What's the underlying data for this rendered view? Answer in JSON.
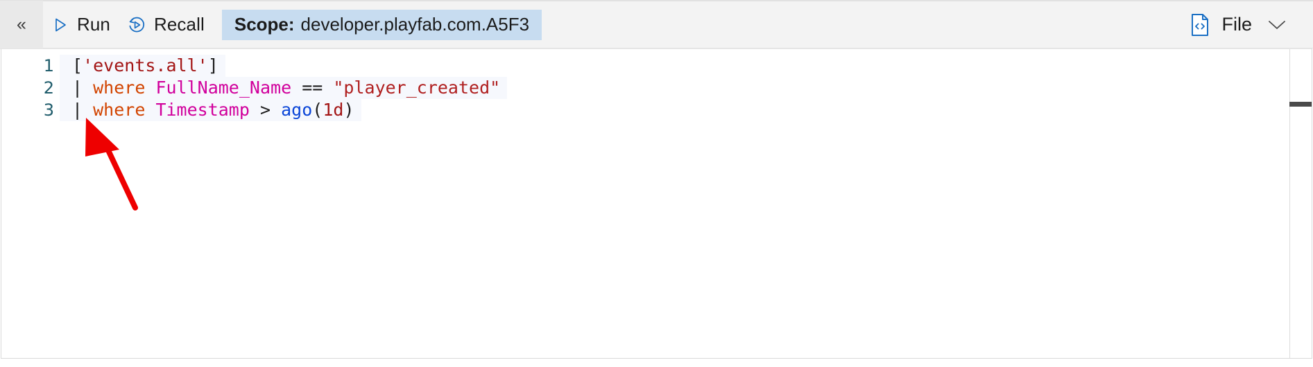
{
  "toolbar": {
    "collapse_label": "«",
    "collapse_icon": "double-chevron-left-icon",
    "run_label": "Run",
    "run_icon": "play-triangle-icon",
    "recall_label": "Recall",
    "recall_icon": "history-replay-icon",
    "scope_key": "Scope:",
    "scope_value": "developer.playfab.com.A5F3",
    "scope_badge_color": "#c7dcf0",
    "file_label": "File",
    "file_icon": "code-document-icon",
    "file_chevron_icon": "chevron-down-icon",
    "accent_color": "#0078d4"
  },
  "editor": {
    "language": "kusto",
    "line_numbers": [
      "1",
      "2",
      "3"
    ],
    "lines": [
      {
        "number": "1",
        "text": "['events.all']",
        "tokens": [
          {
            "t": "[",
            "c": "tok-bracket"
          },
          {
            "t": "'events.all'",
            "c": "tok-string"
          },
          {
            "t": "]",
            "c": "tok-bracket"
          }
        ]
      },
      {
        "number": "2",
        "text": "| where FullName_Name == \"player_created\"",
        "tokens": [
          {
            "t": "|",
            "c": "tok-pipe"
          },
          {
            "t": " ",
            "c": "tok-op"
          },
          {
            "t": "where",
            "c": "tok-kw"
          },
          {
            "t": " ",
            "c": "tok-op"
          },
          {
            "t": "FullName_Name",
            "c": "tok-col"
          },
          {
            "t": " ",
            "c": "tok-op"
          },
          {
            "t": "==",
            "c": "tok-op"
          },
          {
            "t": " ",
            "c": "tok-op"
          },
          {
            "t": "\"player_created\"",
            "c": "tok-str2"
          }
        ]
      },
      {
        "number": "3",
        "text": "| where Timestamp > ago(1d)",
        "tokens": [
          {
            "t": "|",
            "c": "tok-pipe"
          },
          {
            "t": " ",
            "c": "tok-op"
          },
          {
            "t": "where",
            "c": "tok-kw"
          },
          {
            "t": " ",
            "c": "tok-op"
          },
          {
            "t": "Timestamp",
            "c": "tok-col"
          },
          {
            "t": " ",
            "c": "tok-op"
          },
          {
            "t": ">",
            "c": "tok-op"
          },
          {
            "t": " ",
            "c": "tok-op"
          },
          {
            "t": "ago",
            "c": "tok-fn"
          },
          {
            "t": "(",
            "c": "tok-paren"
          },
          {
            "t": "1d",
            "c": "tok-num"
          },
          {
            "t": ")",
            "c": "tok-paren"
          }
        ]
      }
    ]
  },
  "annotation": {
    "arrow_color": "#ee0000",
    "arrow_icon": "red-pointer-arrow",
    "points_to_line": "3"
  }
}
